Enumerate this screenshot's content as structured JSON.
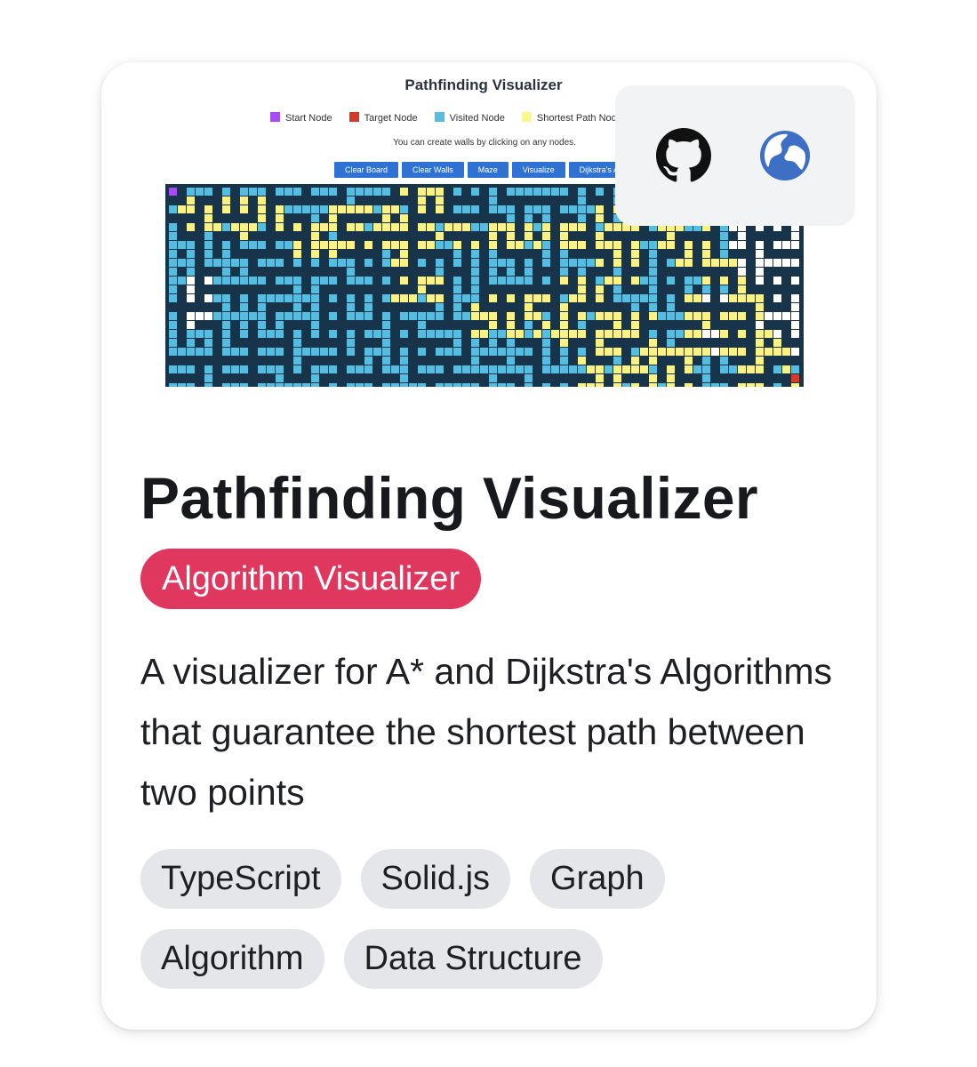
{
  "preview": {
    "title": "Pathfinding Visualizer",
    "legend": [
      {
        "label": "Start Node",
        "color": "#a64cf5"
      },
      {
        "label": "Target Node",
        "color": "#d23b2a"
      },
      {
        "label": "Visited Node",
        "color": "#56bde0"
      },
      {
        "label": "Shortest Path Node",
        "color": "#fdf68b"
      }
    ],
    "hint": "You can create walls by clicking on any nodes.",
    "buttons": [
      "Clear Board",
      "Clear Walls",
      "Maze",
      "Visualize",
      "Dijkstra's Algorithm"
    ],
    "colors": {
      "wall": "#17344a",
      "visited": "#56bde0",
      "path": "#f9f286",
      "unvisited": "#ffffff",
      "start": "#a64cf5",
      "target": "#d23b2a"
    }
  },
  "links": {
    "github_icon": "github-icon",
    "website_icon": "globe-icon",
    "accent": "#3d6fc4"
  },
  "project": {
    "title": "Pathfinding Visualizer",
    "category": "Algorithm Visualizer",
    "category_color": "#e0375f",
    "description": "A visualizer for A* and Dijkstra's Algorithms that guarantee the shortest path between two points",
    "tags": [
      "TypeScript",
      "Solid.js",
      "Graph",
      "Algorithm",
      "Data Structure"
    ]
  }
}
